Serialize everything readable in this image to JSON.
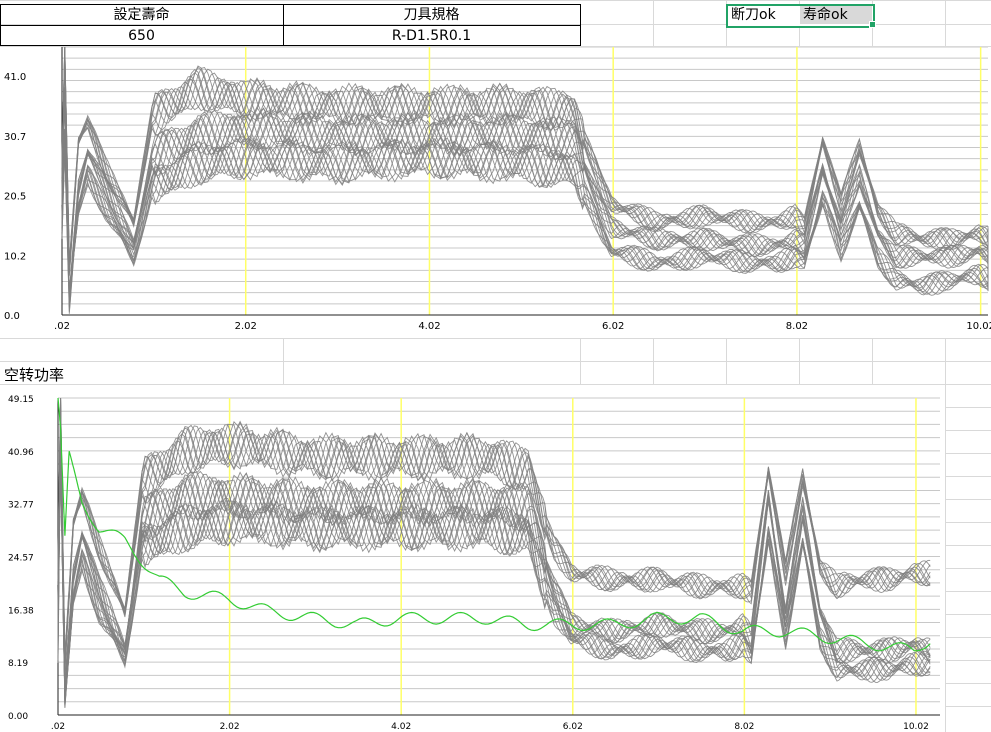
{
  "sheet": {
    "header_life": "設定壽命",
    "header_spec": "刀具規格",
    "value_life": "650",
    "value_spec": "R-D1.5R0.1",
    "status_break": "断刀ok",
    "status_life": "寿命ok"
  },
  "chart_data": [
    {
      "type": "line",
      "title": "",
      "xlabel": "",
      "ylabel": "",
      "xlim": [
        0.02,
        10.1
      ],
      "ylim": [
        0.0,
        46.0
      ],
      "x_ticks": [
        ".02",
        "2.02",
        "4.02",
        "6.02",
        "8.02",
        "10.02"
      ],
      "y_ticks": [
        "0.0",
        "10.2",
        "20.5",
        "30.7",
        "41.0"
      ],
      "grid": true,
      "legend": "none",
      "series_color": "#808080",
      "marker_color": "#ffff66",
      "markers_x": [
        2.02,
        4.02,
        6.02,
        8.02,
        10.02
      ],
      "series": [
        {
          "x": [
            0.02,
            0.05,
            0.1,
            0.2,
            0.3,
            0.5,
            0.8,
            1.0,
            1.5,
            2.0,
            3.0,
            4.0,
            5.0,
            5.6,
            5.9,
            6.0,
            6.5,
            7.0,
            7.5,
            7.8,
            8.0,
            8.1,
            8.3,
            8.5,
            8.7,
            8.9,
            9.1,
            9.4,
            9.7,
            10.0,
            10.3
          ],
          "values": [
            15,
            30,
            2,
            22,
            28,
            22,
            12,
            27,
            31,
            32,
            31,
            31,
            31,
            30,
            18,
            15,
            13,
            13,
            12,
            12,
            13,
            12,
            25,
            15,
            24,
            14,
            10,
            10,
            10,
            11,
            9
          ]
        },
        {
          "x": [
            0.02,
            0.05,
            0.1,
            0.2,
            0.3,
            0.5,
            0.8,
            1.0,
            1.5,
            2.0,
            3.0,
            4.0,
            5.0,
            5.6,
            5.9,
            6.0,
            6.5,
            7.0,
            7.5,
            7.8,
            8.0,
            8.1,
            8.3,
            8.5,
            8.7,
            8.9,
            9.1,
            9.4,
            9.7,
            10.0,
            10.3
          ],
          "values": [
            25,
            45,
            8,
            30,
            33,
            25,
            16,
            34,
            39,
            37,
            36,
            36,
            36,
            35,
            22,
            19,
            16,
            17,
            16,
            16,
            17,
            15,
            30,
            19,
            29,
            18,
            14,
            13,
            13,
            14,
            12
          ]
        },
        {
          "x": [
            0.02,
            0.05,
            0.1,
            0.2,
            0.3,
            0.5,
            0.8,
            1.0,
            1.5,
            2.0,
            3.0,
            4.0,
            5.0,
            5.6,
            5.9,
            6.0,
            6.5,
            7.0,
            7.5,
            7.8,
            8.0,
            8.1,
            8.3,
            8.5,
            8.7,
            8.9,
            9.1,
            9.4,
            9.7,
            10.0,
            10.3
          ],
          "values": [
            20,
            38,
            4,
            18,
            24,
            18,
            10,
            22,
            26,
            27,
            26,
            27,
            26,
            25,
            14,
            11,
            9,
            10,
            9,
            9,
            10,
            9,
            20,
            11,
            19,
            10,
            6,
            5,
            6,
            7,
            5
          ]
        }
      ]
    },
    {
      "type": "line",
      "title": "空转功率",
      "xlabel": "",
      "ylabel": "",
      "xlim": [
        0.02,
        10.3
      ],
      "ylim": [
        0.0,
        49.15
      ],
      "x_ticks": [
        ".02",
        "2.02",
        "4.02",
        "6.02",
        "8.02",
        "10.02"
      ],
      "y_ticks": [
        "0.00",
        "8.19",
        "16.38",
        "24.57",
        "32.77",
        "40.96",
        "49.15"
      ],
      "grid": true,
      "legend": "none",
      "series_color": "#808080",
      "highlight_color": "#33cc33",
      "marker_color": "#ffff66",
      "markers_x": [
        2.02,
        4.02,
        6.02,
        8.02,
        10.02
      ],
      "series": [
        {
          "x": [
            0.02,
            0.05,
            0.1,
            0.2,
            0.3,
            0.5,
            0.8,
            1.0,
            1.5,
            2.0,
            3.0,
            4.0,
            5.0,
            5.5,
            5.8,
            6.0,
            6.5,
            7.0,
            7.5,
            7.8,
            8.0,
            8.1,
            8.3,
            8.5,
            8.7,
            8.9,
            9.1,
            9.4,
            9.7,
            10.0,
            10.2
          ],
          "values": [
            10,
            45,
            3,
            22,
            28,
            20,
            10,
            30,
            34,
            34,
            33,
            33,
            33,
            32,
            20,
            14,
            13,
            14,
            13,
            13,
            14,
            12,
            34,
            15,
            32,
            16,
            10,
            10,
            10,
            11,
            10
          ]
        },
        {
          "x": [
            0.02,
            0.05,
            0.1,
            0.2,
            0.3,
            0.5,
            0.8,
            1.0,
            1.5,
            2.0,
            3.0,
            4.0,
            5.0,
            5.5,
            5.8,
            6.0,
            6.5,
            7.0,
            7.5,
            7.8,
            8.0,
            8.1,
            8.3,
            8.5,
            8.7,
            8.9,
            9.1,
            9.4,
            9.7,
            10.0,
            10.2
          ],
          "values": [
            22,
            48,
            8,
            30,
            34,
            26,
            16,
            36,
            41,
            42,
            40,
            40,
            40,
            38,
            26,
            22,
            21,
            21,
            20,
            20,
            20,
            19,
            38,
            22,
            37,
            23,
            20,
            21,
            21,
            22,
            22
          ]
        },
        {
          "x": [
            0.02,
            0.05,
            0.1,
            0.2,
            0.3,
            0.5,
            0.8,
            1.0,
            1.5,
            2.0,
            3.0,
            4.0,
            5.0,
            5.5,
            5.8,
            6.0,
            6.5,
            7.0,
            7.5,
            7.8,
            8.0,
            8.1,
            8.3,
            8.5,
            8.7,
            8.9,
            9.1,
            9.4,
            9.7,
            10.0,
            10.2
          ],
          "values": [
            15,
            40,
            2,
            18,
            24,
            16,
            9,
            26,
            29,
            30,
            29,
            29,
            29,
            28,
            16,
            12,
            10,
            11,
            10,
            10,
            11,
            9,
            28,
            12,
            27,
            12,
            7,
            7,
            7,
            8,
            8
          ]
        },
        {
          "name": "",
          "highlight": true,
          "x": [
            0.02,
            0.05,
            0.1,
            0.15,
            0.3,
            0.5,
            0.8,
            1.0,
            1.2,
            1.5,
            2.0,
            2.5,
            3.0,
            3.5,
            4.0,
            4.5,
            5.0,
            5.5,
            6.0,
            6.5,
            7.0,
            7.5,
            8.0,
            8.5,
            9.0,
            9.5,
            10.0,
            10.2
          ],
          "values": [
            49,
            44,
            27,
            40,
            33,
            29,
            27,
            24,
            21,
            19,
            18,
            16,
            15,
            14,
            15,
            15,
            15,
            14,
            14,
            14,
            15,
            15,
            13,
            13,
            12,
            11,
            10,
            12
          ]
        }
      ]
    }
  ]
}
